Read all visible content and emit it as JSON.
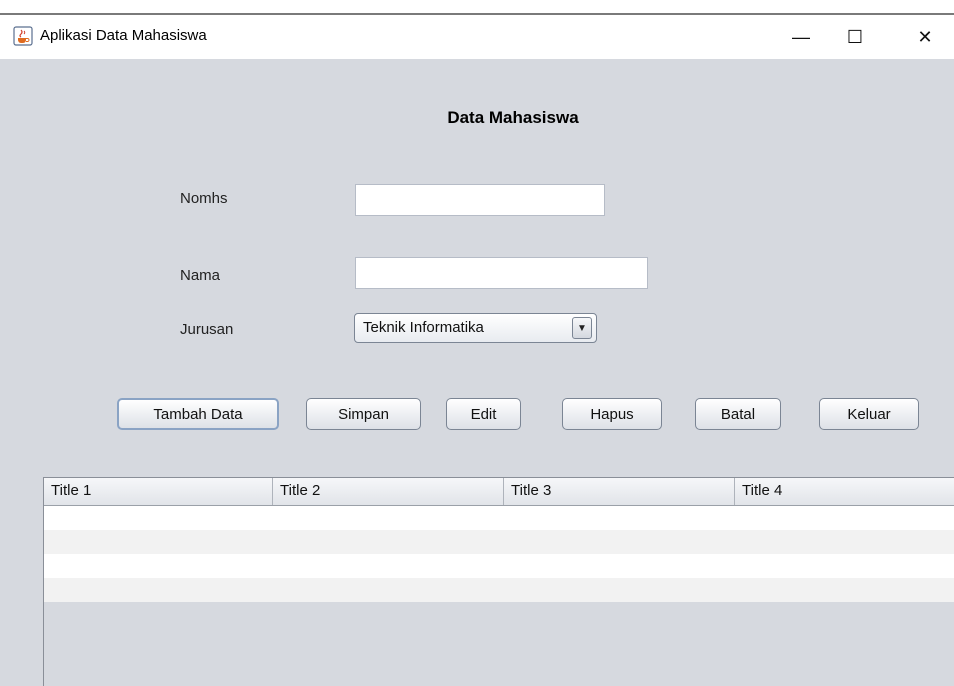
{
  "window": {
    "title": "Aplikasi Data Mahasiswa",
    "controls": {
      "minimize": "—",
      "maximize": "☐",
      "close": "✕"
    }
  },
  "form": {
    "heading": "Data Mahasiswa",
    "nomhs_label": "Nomhs",
    "nomhs_value": "",
    "nama_label": "Nama",
    "nama_value": "",
    "jurusan_label": "Jurusan",
    "jurusan_selected": "Teknik Informatika"
  },
  "buttons": {
    "tambah": "Tambah Data",
    "simpan": "Simpan",
    "edit": "Edit",
    "hapus": "Hapus",
    "batal": "Batal",
    "keluar": "Keluar"
  },
  "table": {
    "columns": [
      "Title 1",
      "Title 2",
      "Title 3",
      "Title 4"
    ],
    "rows": [
      [
        "",
        "",
        "",
        ""
      ],
      [
        "",
        "",
        "",
        ""
      ],
      [
        "",
        "",
        "",
        ""
      ],
      [
        "",
        "",
        "",
        ""
      ]
    ]
  },
  "colors": {
    "client_bg": "#d6d9df",
    "row_even": "#ffffff",
    "row_odd": "#f2f2f2"
  },
  "icons": {
    "app": "java-coffee-icon",
    "combo_arrow": "triangle-down-icon"
  }
}
